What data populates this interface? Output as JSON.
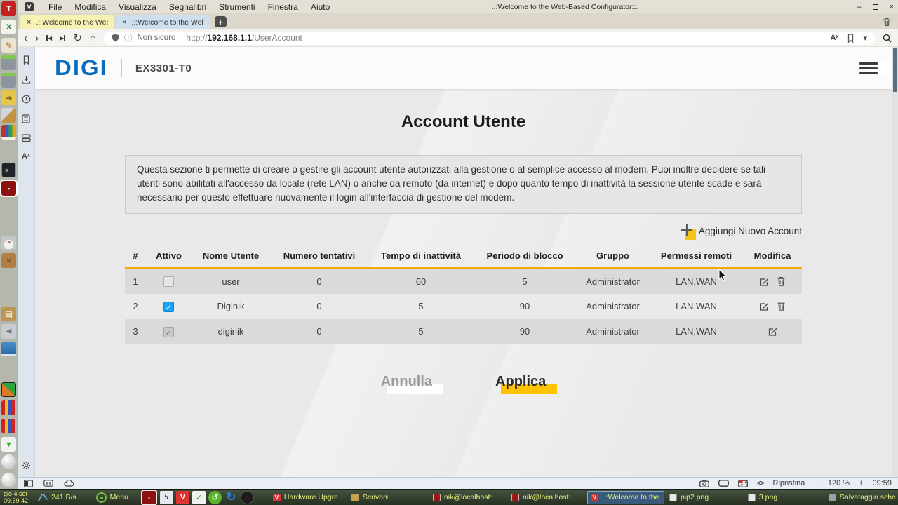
{
  "menubar": {
    "menus": [
      "File",
      "Modifica",
      "Visualizza",
      "Segnalibri",
      "Strumenti",
      "Finestra",
      "Aiuto"
    ],
    "window_title": ".::Welcome to the Web-Based Configurator::.",
    "minimize_glyph": "–",
    "close_glyph": "×"
  },
  "tabbar": {
    "close_glyph": "×",
    "new_tab_glyph": "+",
    "tabs": [
      {
        "label": ".::Welcome to the Web-Ba"
      },
      {
        "label": ".::Welcome to the Web-Ba"
      }
    ]
  },
  "addressbar": {
    "security_label": "Non sicuro",
    "url_scheme": "http://",
    "url_host": "192.168.1.1",
    "url_path": "/UserAccount",
    "reader_glyph": "Aˣ"
  },
  "panel": {
    "translate_glyph": "Aˣ"
  },
  "page": {
    "brand": "DIGI",
    "model": "EX3301-T0",
    "title": "Account Utente",
    "description": "Questa sezione ti permette di creare o gestire gli account utente autorizzati alla gestione o al semplice accesso al modem. Puoi inoltre decidere se tali utenti sono abilitati all'accesso da locale (rete LAN) o anche da remoto (da internet) e dopo quanto tempo di inattività la sessione utente scade e sarà necessario per questo effettuare nuovamente il login all'interfaccia di gestione del modem.",
    "add_account_label": "Aggiungi Nuovo Account",
    "table": {
      "headers": [
        "#",
        "Attivo",
        "Nome Utente",
        "Numero tentativi",
        "Tempo di inattività",
        "Periodo di blocco",
        "Gruppo",
        "Permessi remoti",
        "Modifica"
      ],
      "rows": [
        {
          "num": "1",
          "active_state": "unchecked",
          "name": "user",
          "attempts": "0",
          "inactivity": "60",
          "lock": "5",
          "group": "Administrator",
          "perms": "LAN,WAN"
        },
        {
          "num": "2",
          "active_state": "checked",
          "name": "Diginik",
          "attempts": "0",
          "inactivity": "5",
          "lock": "90",
          "group": "Administrator",
          "perms": "LAN,WAN"
        },
        {
          "num": "3",
          "active_state": "checked-disabled",
          "name": "diginik",
          "attempts": "0",
          "inactivity": "5",
          "lock": "90",
          "group": "Administrator",
          "perms": "LAN,WAN"
        }
      ]
    },
    "cancel_label": "Annulla",
    "apply_label": "Applica",
    "colors": {
      "accent_yellow": "#eead00",
      "brand_blue": "#0b6cbf",
      "checkbox_blue": "#1aa3f2"
    }
  },
  "statusbar": {
    "reset_zoom_label": "Ripristina",
    "zoom_out_glyph": "−",
    "zoom_level": "120 %",
    "zoom_in_glyph": "+",
    "time": "09:59"
  },
  "taskbar": {
    "clock_date": "gio 4 set",
    "clock_time": "09.59.42",
    "net_rate": "241 B/s",
    "menu_label": "Menu",
    "windows": [
      {
        "label": "Hardware Upgrad..."
      },
      {
        "label": "Scrivania"
      },
      {
        "label": "nik@localhost:/uni..."
      },
      {
        "label": "nik@localhost:/uni..."
      },
      {
        "label": ".::Welcome to the ...",
        "active": true
      },
      {
        "label": "pip2.png"
      },
      {
        "label": "3.png"
      },
      {
        "label": "Salvataggio scher..."
      }
    ]
  },
  "dock": {
    "items": [
      "texstudio",
      "spreadsheet",
      "notes",
      "calculator",
      "calculator-2",
      "folder-shortcut",
      "cleaner",
      "stats-book",
      "terminal",
      "red-package-active",
      "system-monitor",
      "package",
      "clipboard",
      "audio-player",
      "network-computers",
      "media-app",
      "pencils",
      "pencils-2",
      "downloader",
      "sphere-app",
      "sphere-app-2"
    ]
  }
}
